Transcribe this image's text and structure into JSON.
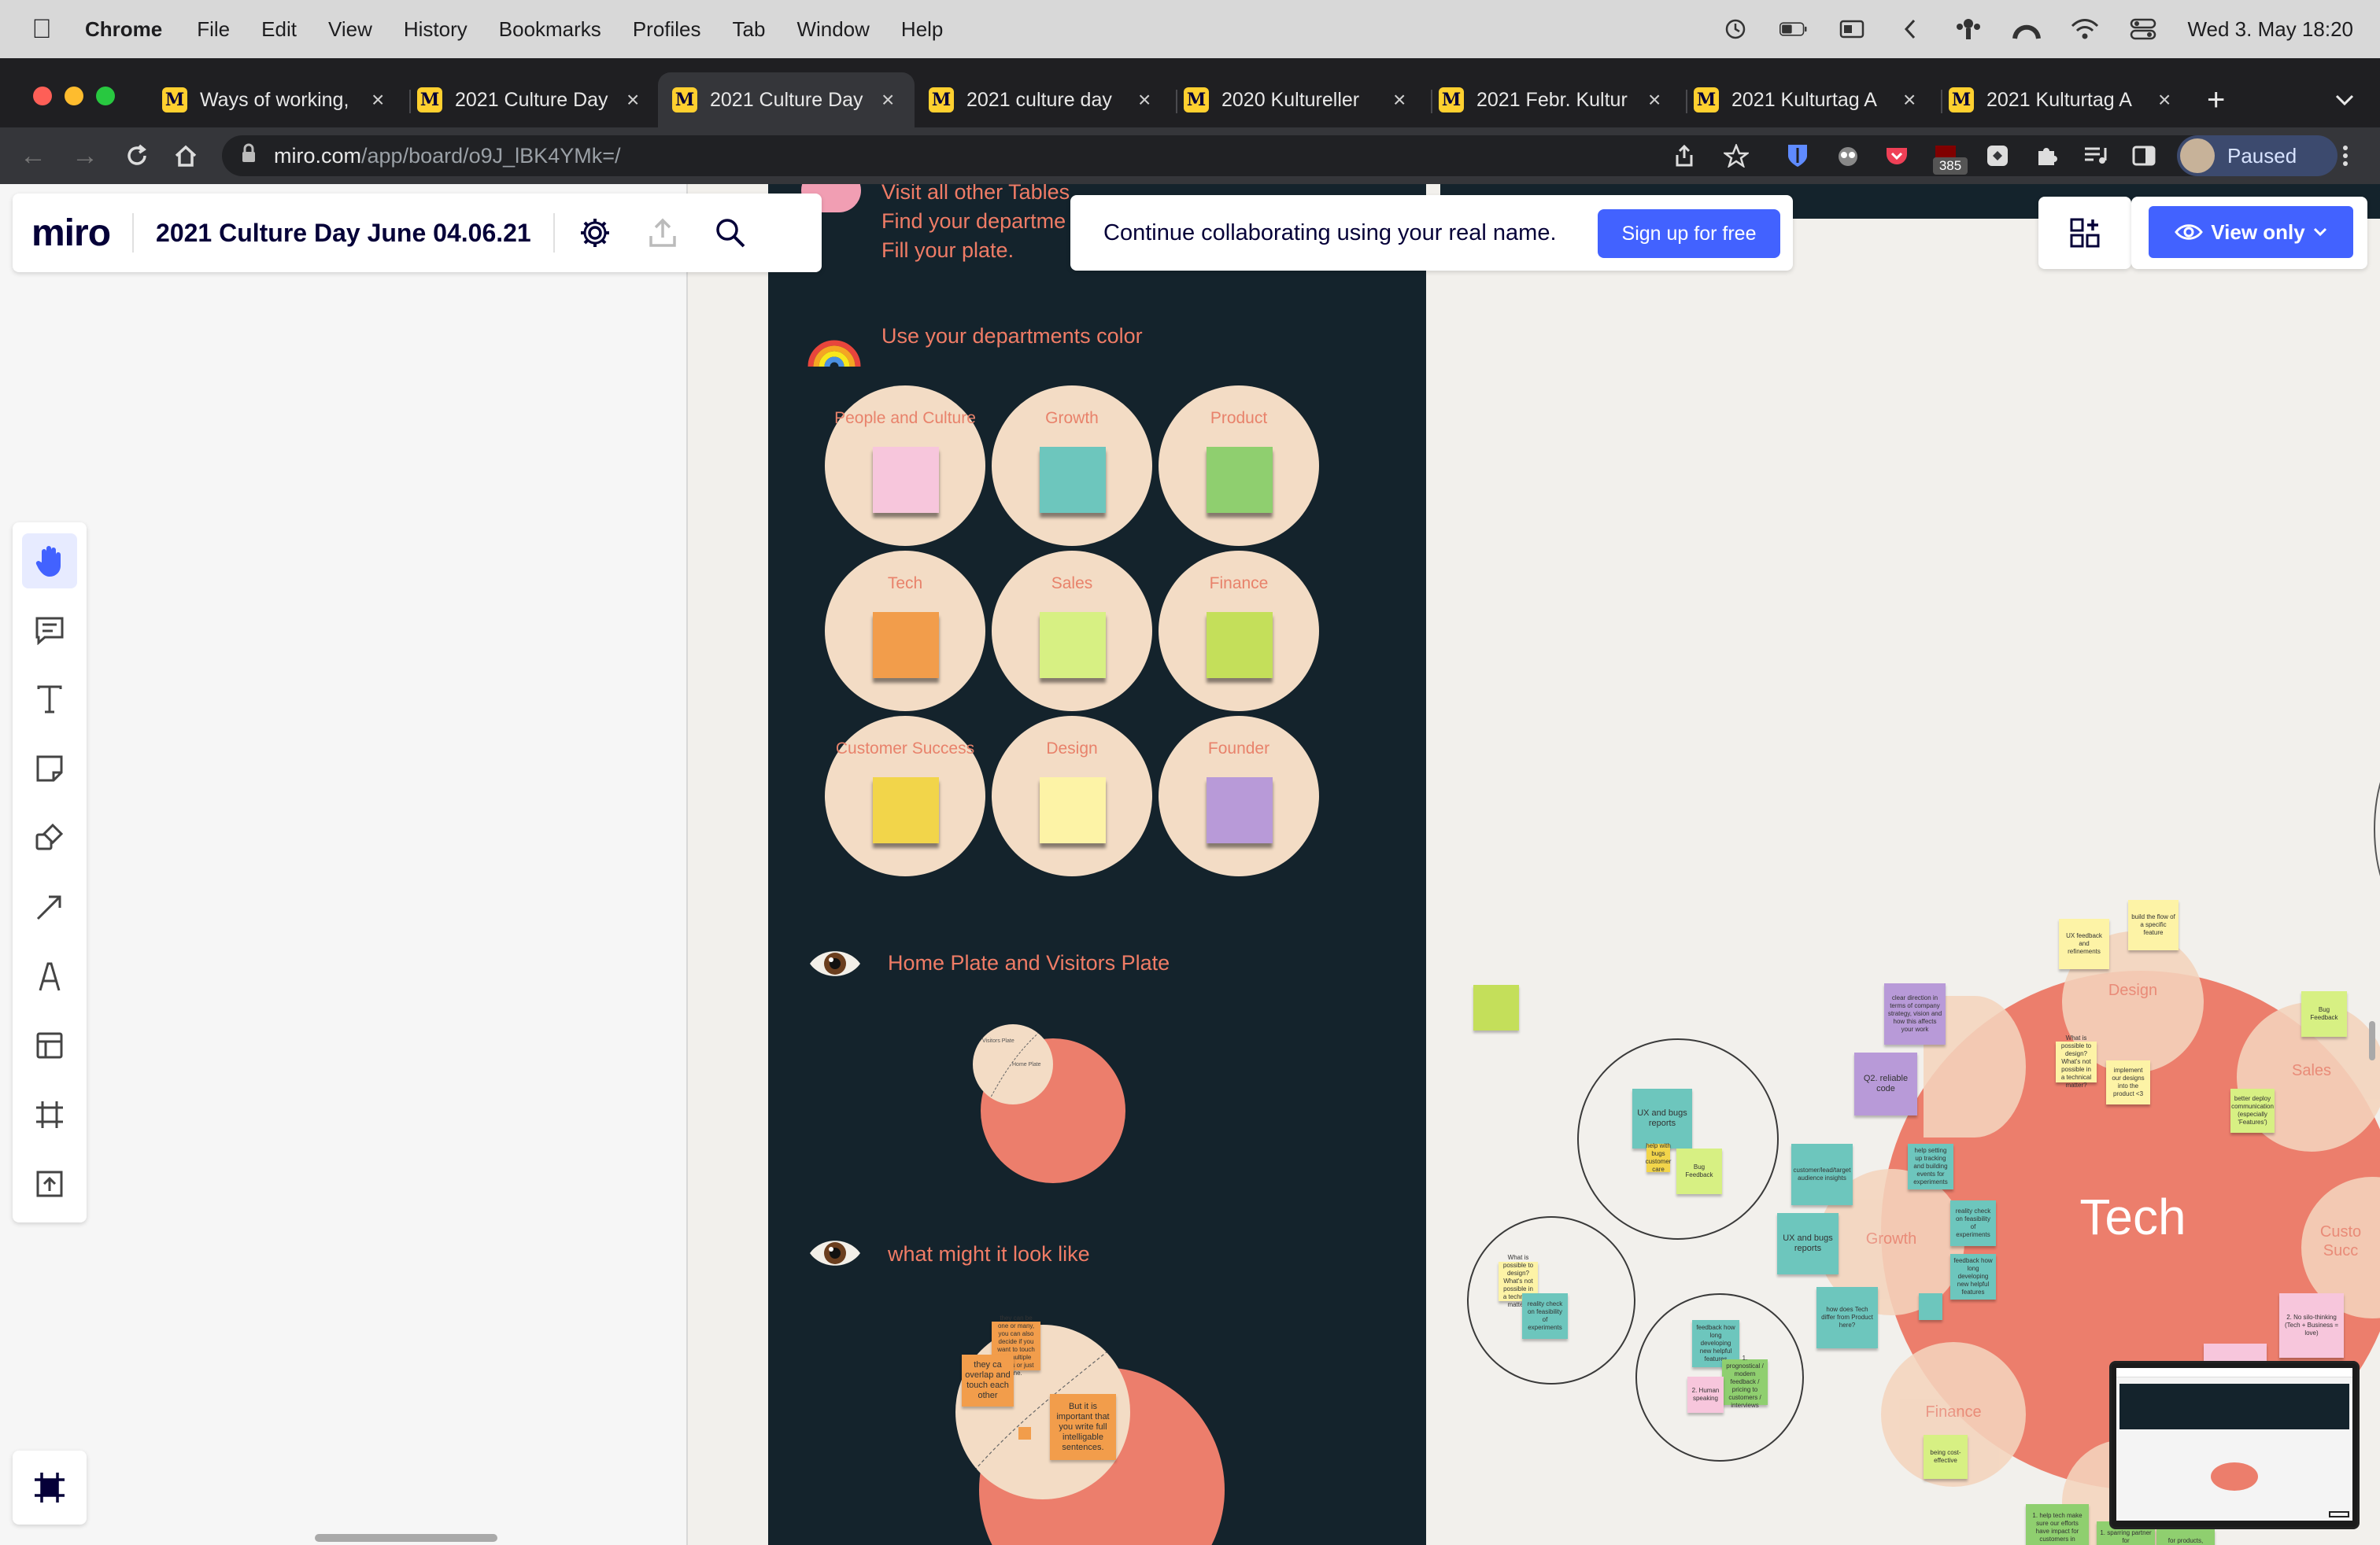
{
  "menubar": {
    "app": "Chrome",
    "items": [
      "File",
      "Edit",
      "View",
      "History",
      "Bookmarks",
      "Profiles",
      "Tab",
      "Window",
      "Help"
    ],
    "clock": "Wed 3. May  18:20"
  },
  "tabs": [
    {
      "label": "Ways of working,"
    },
    {
      "label": "2021 Culture Day"
    },
    {
      "label": "2021 Culture Day"
    },
    {
      "label": "2021 culture day"
    },
    {
      "label": "2020 Kultureller"
    },
    {
      "label": "2021 Febr. Kultur"
    },
    {
      "label": "2021 Kulturtag A"
    },
    {
      "label": "2021 Kulturtag A"
    }
  ],
  "omnibox": {
    "url_host": "miro.com",
    "url_path": "/app/board/o9J_lBK4YMk=/"
  },
  "extensions": {
    "badge": "385",
    "profile_label": "Paused"
  },
  "miro": {
    "logo": "miro",
    "board_title": "2021 Culture Day June 04.06.21",
    "signup_message": "Continue collaborating using your real name.",
    "signup_button": "Sign up for free",
    "view_button": "View only"
  },
  "panel": {
    "intro_lines": [
      "Visit all other Tables",
      "Find your departme",
      "Fill your plate."
    ],
    "colors_heading": "Use your departments color",
    "departments": [
      {
        "label": "People and Culture",
        "color": "#f7c6dc"
      },
      {
        "label": "Growth",
        "color": "#6dc6bd"
      },
      {
        "label": "Product",
        "color": "#8fcf6f"
      },
      {
        "label": "Tech",
        "color": "#f29d4b"
      },
      {
        "label": "Sales",
        "color": "#d7f083"
      },
      {
        "label": "Finance",
        "color": "#c4df5a"
      },
      {
        "label": "Customer Success",
        "color": "#f2d54a"
      },
      {
        "label": "Design",
        "color": "#fdf3a6"
      },
      {
        "label": "Founder",
        "color": "#b89ad8"
      }
    ],
    "plate_heading": "Home Plate and Visitors Plate",
    "visitors_plate": "Visitors Plate",
    "home_plate": "Home Plate",
    "look_heading": "what might it look like",
    "look_notes": {
      "n1": "they can be one or many, you can also decide if you want to touch on multiple topics or just one.",
      "n2": "they ca overlap and touch each other",
      "n3": "But it is important that you write full intelligable sentences."
    }
  },
  "canvas": {
    "tech_label": "Tech",
    "bubbles": {
      "design": "Design",
      "sales": "Sales",
      "growth": "Growth",
      "finance": "Finance",
      "customer": "Custo Succ"
    },
    "notes": {
      "build_flow": "build the flow of a specific feature",
      "ux_feedback": "UX feedback and refinements",
      "bug_feedback_top": "Bug Feedback",
      "clear_direction": "clear direction in terms of company strategy, vision and how this affects your work",
      "q2_code": "Q2. reliable code",
      "more_possible": "What is possible to design? What's not possible in a technical matter?",
      "implement_designs": "implement our designs into the product <3",
      "better_deploy": "better deploy communication (especially 'Features')",
      "ux_bugs_1": "UX and bugs reports",
      "help_bugs": "help with bugs customer care",
      "bug_feedback": "Bug Feedback",
      "customer_lead": "customer/lead/target audience insights",
      "help_setting": "help setting up tracking and building events for experiments",
      "reality_check_1": "reality check on feasibility of experiments",
      "feedback_long_1": "feedback how long developing new helpful features",
      "ux_bugs_2": "UX and bugs reports",
      "how_does_tech": "how does Tech differ from Product here?",
      "what_possible": "What is possible to design? What's not possible in a technical matter?",
      "reality_check_2": "reality check on feasibility of experiments",
      "feedback_long_2": "feedback how long developing new helpful features",
      "prognostic": "1. prognostical / modern feedback / pricing to customers / interviews",
      "human_speaking": "2. Human speaking",
      "no_silo": "2. No silo-thinking (Tech + Business = love)",
      "cost_effective": "being cost-effective",
      "help_tech": "1. help tech make sure our efforts have impact for customers in",
      "sparring": "1. sparring partner for",
      "for_products": "for products,"
    }
  }
}
